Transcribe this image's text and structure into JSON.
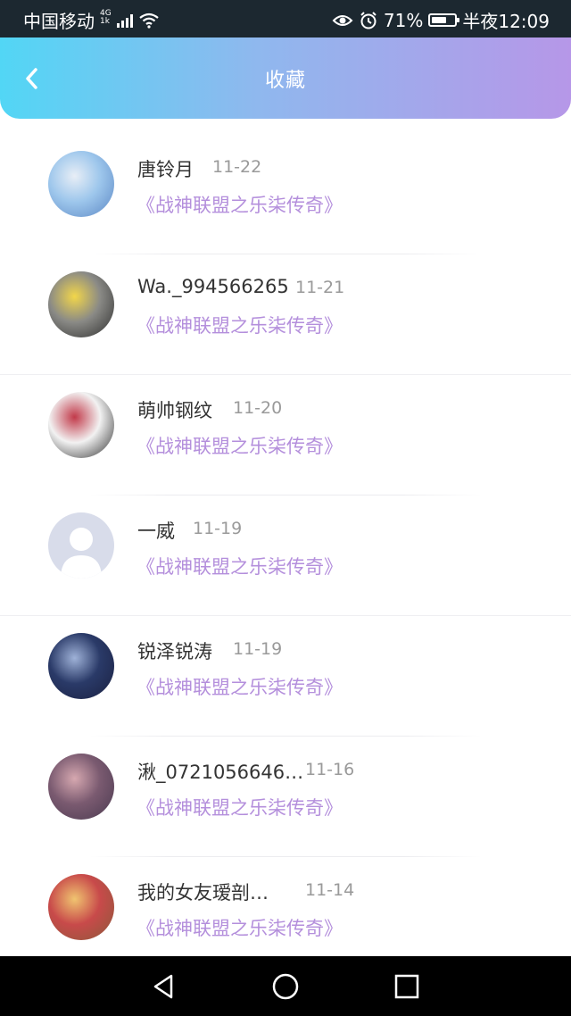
{
  "status_bar": {
    "carrier": "中国移动",
    "network_top": "4G",
    "network_bottom": "1k",
    "battery_pct": "71%",
    "battery_level": 0.71,
    "time": "半夜12:09"
  },
  "header": {
    "title": "收藏",
    "gradient": [
      "#52d6f5",
      "#b697e8"
    ]
  },
  "list": [
    {
      "name": "唐铃月",
      "date": "11-22",
      "book": "《战神联盟之乐柒传奇》",
      "avatar_colors": [
        "#9ec7ec",
        "#e8eef6",
        "#5a86c4"
      ]
    },
    {
      "name": "Wa._994566265",
      "date": "11-21",
      "book": "《战神联盟之乐柒传奇》",
      "avatar_colors": [
        "#8a8a86",
        "#f2d64a",
        "#2c2c2c"
      ]
    },
    {
      "name": "萌帅钢纹",
      "date": "11-20",
      "book": "《战神联盟之乐柒传奇》",
      "avatar_colors": [
        "#f2f2f2",
        "#c23a4a",
        "#2a2a2a"
      ]
    },
    {
      "name": "一威",
      "date": "11-19",
      "book": "《战神联盟之乐柒传奇》",
      "avatar_colors": [
        "#d8dcea",
        "#ffffff",
        "#c9cfe0"
      ]
    },
    {
      "name": "锐泽锐涛",
      "date": "11-19",
      "book": "《战神联盟之乐柒传奇》",
      "avatar_colors": [
        "#2a3a68",
        "#9fb2d8",
        "#1a2040"
      ]
    },
    {
      "name": "湫_0721056646…",
      "date": "11-16",
      "book": "《战神联盟之乐柒传奇》",
      "avatar_colors": [
        "#7a5a70",
        "#d6a8b0",
        "#4a3a50"
      ]
    },
    {
      "name": "我的女友瑷剖…",
      "date": "11-14",
      "book": "《战神联盟之乐柒传奇》",
      "avatar_colors": [
        "#c84a4a",
        "#f0c470",
        "#8a5a3a"
      ]
    }
  ],
  "nav": {
    "back_icon": "triangle-back-icon",
    "home_icon": "circle-home-icon",
    "recents_icon": "square-recents-icon"
  },
  "colors": {
    "book_title": "#b48fdc",
    "date": "#9a9a9a",
    "name": "#333333"
  }
}
